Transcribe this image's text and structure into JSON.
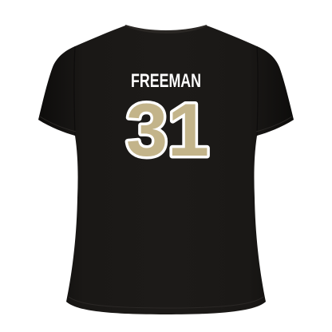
{
  "product": {
    "player_name": "FREEMAN",
    "player_number": "31",
    "view": "back",
    "shirt_color": "#151312",
    "number_fill_color": "#c3b48a",
    "number_outline_color": "#ffffff",
    "name_color": "#ffffff",
    "background_color": "#ffffff"
  }
}
